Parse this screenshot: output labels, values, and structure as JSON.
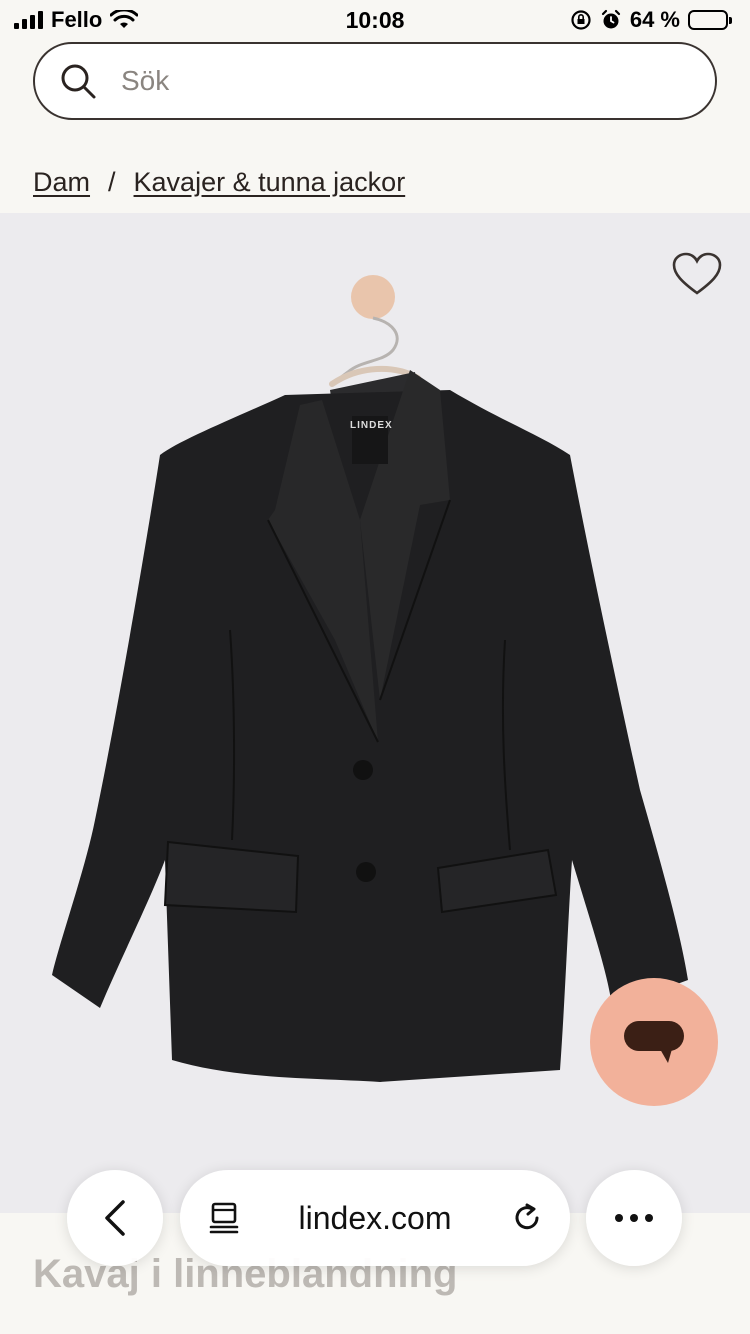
{
  "status_bar": {
    "carrier": "Fello",
    "time": "10:08",
    "battery": "64 %",
    "battery_level": 0.64
  },
  "search": {
    "placeholder": "Sök",
    "icon": "search-icon"
  },
  "breadcrumb": {
    "items": [
      "Dam",
      "Kavajer & tunna jackor"
    ],
    "separator": "/"
  },
  "product": {
    "image_alt": "black-blazer-on-hanger",
    "brand_tag": "LINDEX",
    "title": "Kavaj i linneblandning",
    "favorite_icon": "heart-icon"
  },
  "chat": {
    "icon": "chat-bubble-icon",
    "color": "#f2b19a"
  },
  "browser": {
    "url": "lindex.com",
    "back_icon": "chevron-left-icon",
    "reader_icon": "reader-mode-icon",
    "reload_icon": "reload-icon",
    "more_icon": "more-icon"
  }
}
